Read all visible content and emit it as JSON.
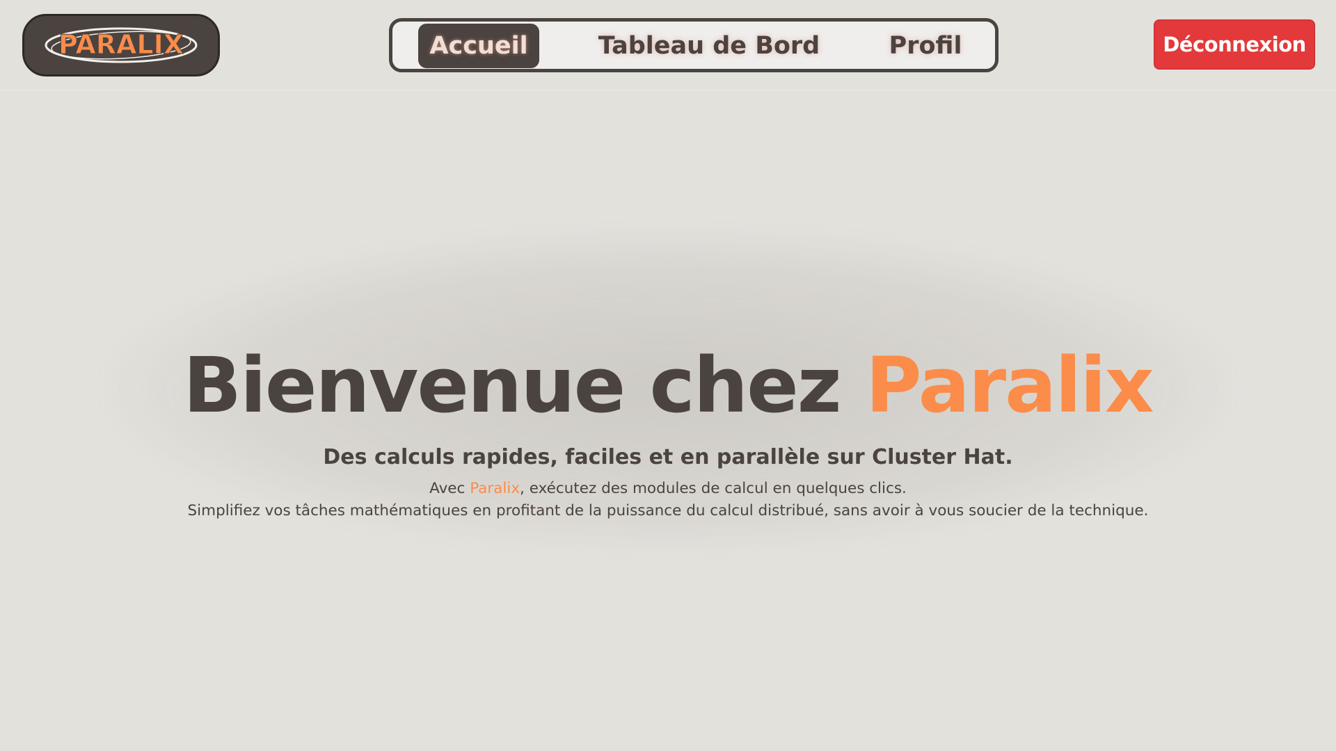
{
  "header": {
    "logo_text": "PARALIX",
    "nav": [
      {
        "label": "Accueil",
        "active": true
      },
      {
        "label": "Tableau de Bord",
        "active": false
      },
      {
        "label": "Profil",
        "active": false
      }
    ],
    "logout_label": "Déconnexion"
  },
  "hero": {
    "title_prefix": "Bienvenue chez ",
    "title_brand": "Paralix",
    "subtitle": "Des calculs rapides, faciles et en parallèle sur Cluster Hat.",
    "line1_prefix": "Avec ",
    "line1_brand": "Paralix",
    "line1_suffix": ", exécutez des modules de calcul en quelques clics.",
    "line2": "Simplifiez vos tâches mathématiques en profitant de la puissance du calcul distribué, sans avoir à vous soucier de la technique."
  },
  "colors": {
    "accent": "#fb8c4a",
    "dark": "#4a4340",
    "background": "#e3e1dc",
    "logout": "#e3393a"
  }
}
